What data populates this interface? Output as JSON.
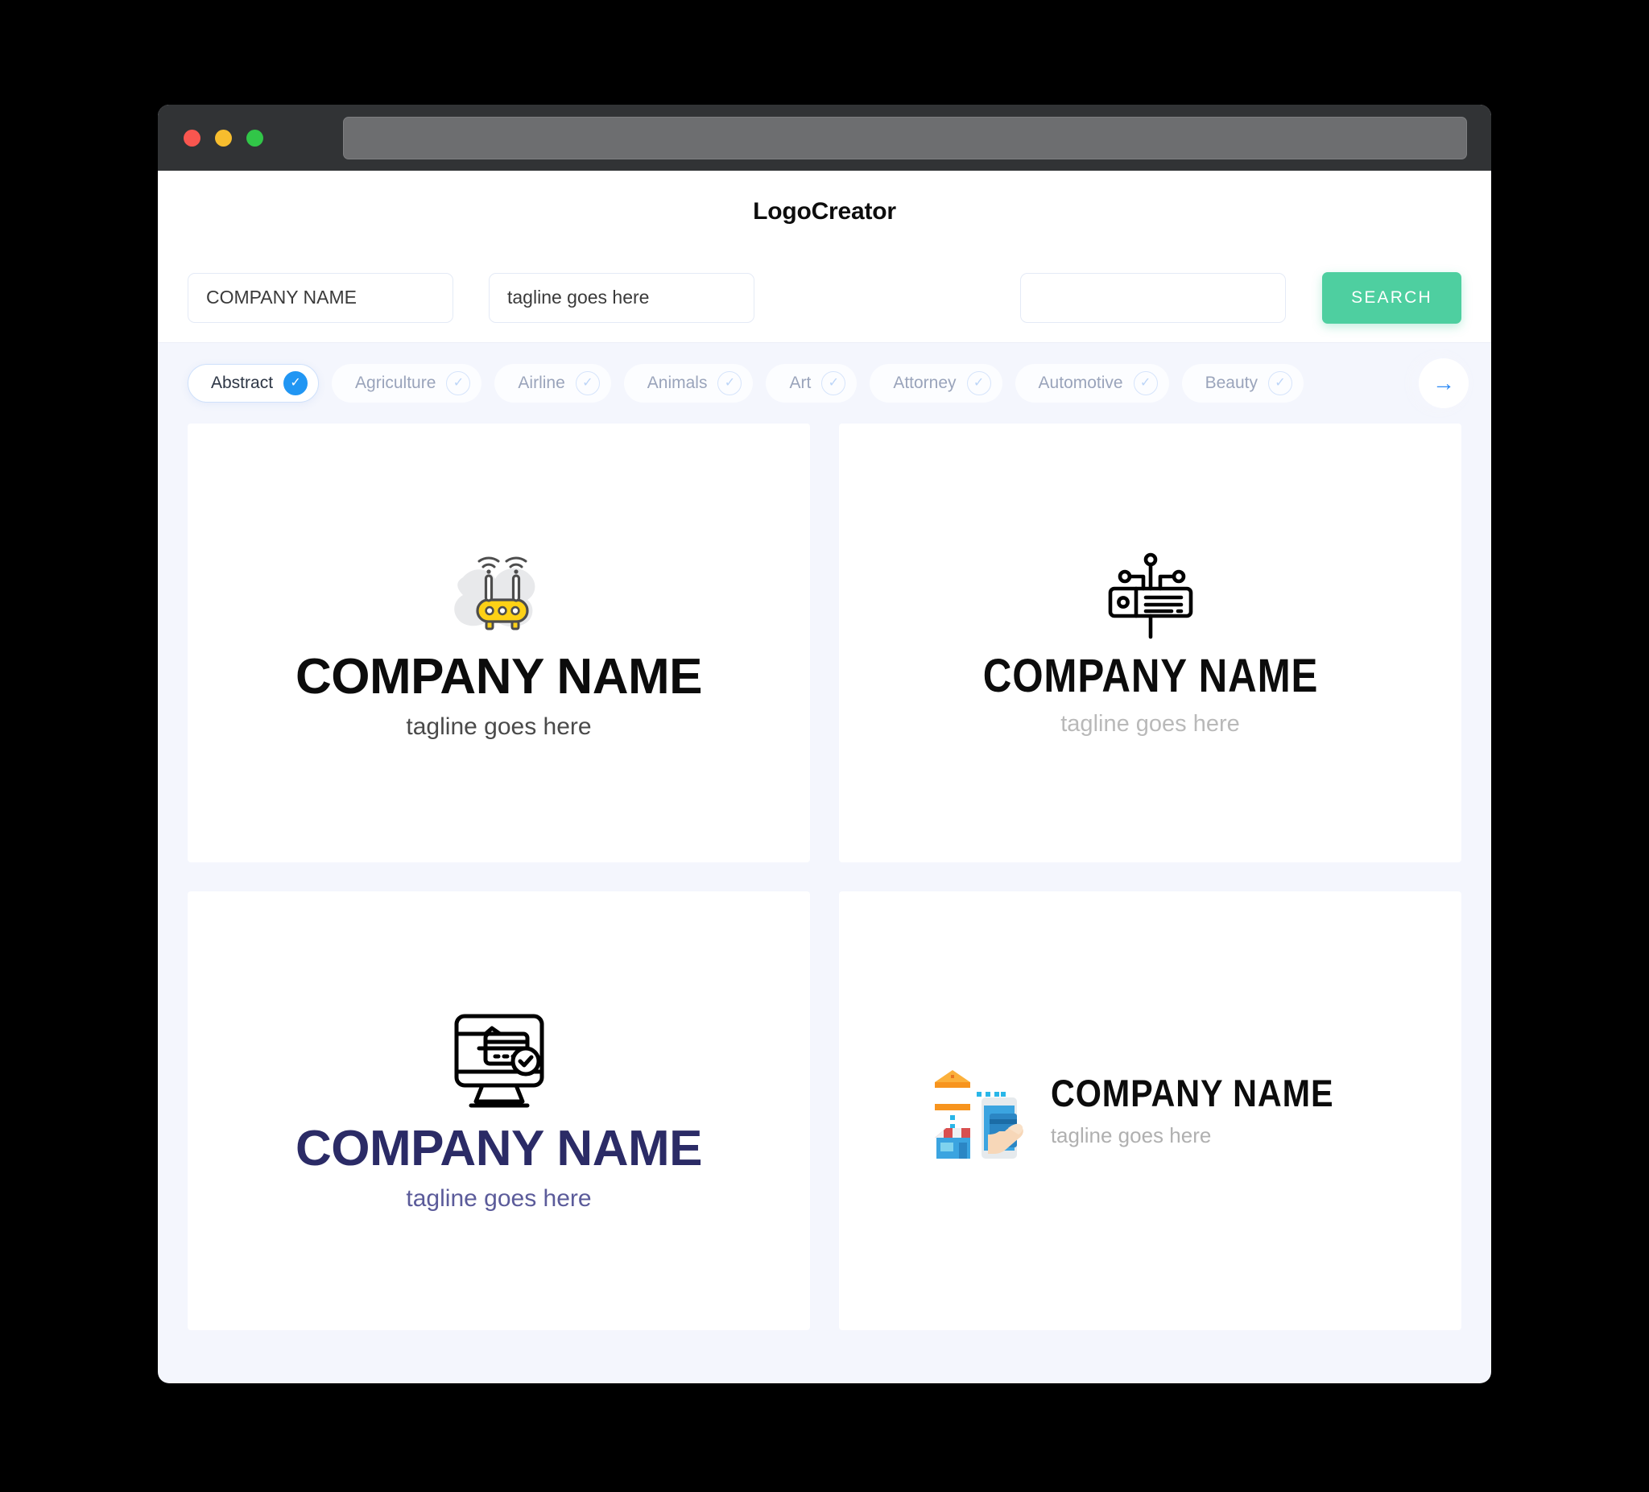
{
  "window": {
    "traffic_lights": [
      "close",
      "minimize",
      "maximize"
    ],
    "url_bar_value": ""
  },
  "header": {
    "title": "LogoCreator"
  },
  "search": {
    "company_name_value": "COMPANY NAME",
    "company_name_placeholder": "COMPANY NAME",
    "tagline_value": "tagline goes here",
    "tagline_placeholder": "tagline goes here",
    "keyword_value": "",
    "keyword_placeholder": "",
    "button_label": "SEARCH",
    "button_color": "#4ecfa0"
  },
  "categories": {
    "next_icon": "arrow-right-icon",
    "items": [
      {
        "label": "Abstract",
        "selected": true
      },
      {
        "label": "Agriculture",
        "selected": false
      },
      {
        "label": "Airline",
        "selected": false
      },
      {
        "label": "Animals",
        "selected": false
      },
      {
        "label": "Art",
        "selected": false
      },
      {
        "label": "Attorney",
        "selected": false
      },
      {
        "label": "Automotive",
        "selected": false
      },
      {
        "label": "Beauty",
        "selected": false
      }
    ],
    "active_color": "#2196f3"
  },
  "logos": [
    {
      "icon": "wifi-router-icon",
      "name": "COMPANY NAME",
      "tagline": "tagline goes here",
      "name_color": "#0c0c0c",
      "tagline_color": "#4a4a4a"
    },
    {
      "icon": "network-server-icon",
      "name": "COMPANY NAME",
      "tagline": "tagline goes here",
      "name_color": "#0c0c0c",
      "tagline_color": "#b9b9b9"
    },
    {
      "icon": "monitor-card-payment-icon",
      "name": "COMPANY NAME",
      "tagline": "tagline goes here",
      "name_color": "#2b2b66",
      "tagline_color": "#5b5b9a"
    },
    {
      "icon": "bank-mobile-payment-icon",
      "name": "COMPANY NAME",
      "tagline": "tagline goes here",
      "name_color": "#0c0c0c",
      "tagline_color": "#b0b0b0"
    }
  ]
}
